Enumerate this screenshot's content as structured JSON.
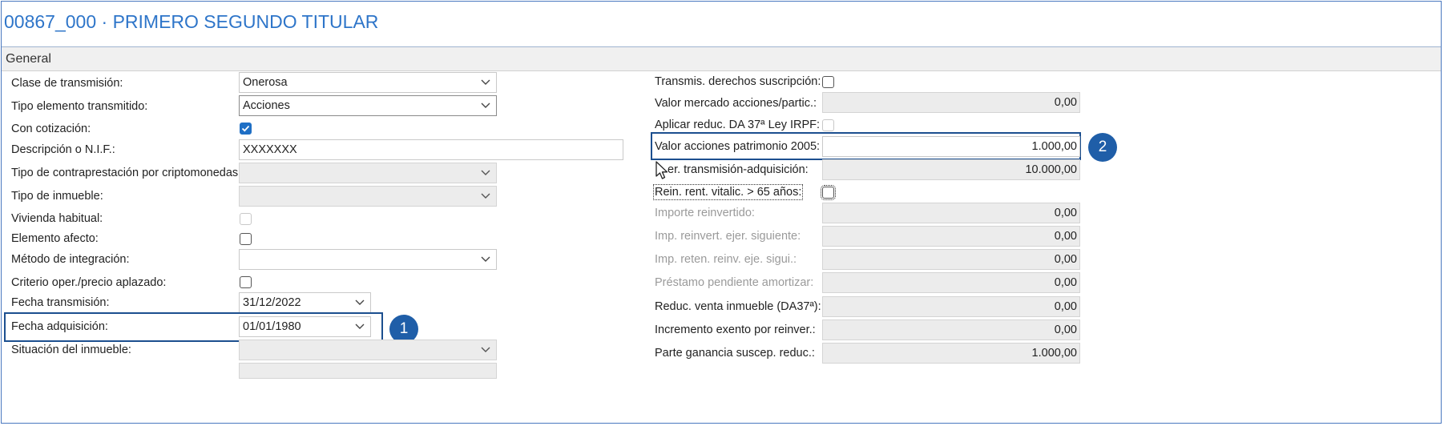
{
  "window": {
    "title": "00867_000 · PRIMERO SEGUNDO TITULAR",
    "section": "General"
  },
  "left": {
    "clase_transmision": {
      "label": "Clase de transmisión:",
      "value": "Onerosa"
    },
    "tipo_elemento": {
      "label": "Tipo elemento transmitido:",
      "value": "Acciones"
    },
    "con_cotizacion": {
      "label": "Con cotización:",
      "checked": true
    },
    "descripcion_nif": {
      "label": "Descripción o N.I.F.:",
      "value": "XXXXXXX"
    },
    "tipo_contraprestacion": {
      "label": "Tipo de contraprestación por criptomonedas:",
      "value": ""
    },
    "tipo_inmueble": {
      "label": "Tipo de inmueble:",
      "value": ""
    },
    "vivienda_habitual": {
      "label": "Vivienda habitual:",
      "checked": false
    },
    "elemento_afecto": {
      "label": "Elemento afecto:",
      "checked": false
    },
    "metodo_integracion": {
      "label": "Método de integración:",
      "value": ""
    },
    "criterio_oper": {
      "label": "Criterio oper./precio aplazado:",
      "checked": false
    },
    "fecha_transmision": {
      "label": "Fecha transmisión:",
      "value": "31/12/2022"
    },
    "fecha_adquisicion": {
      "label": "Fecha adquisición:",
      "value": "01/01/1980"
    },
    "situacion_inmueble": {
      "label": "Situación del inmueble:",
      "value": ""
    }
  },
  "right": {
    "transmis_derechos": {
      "label": "Transmis. derechos suscripción:",
      "checked": false
    },
    "valor_mercado": {
      "label": "Valor mercado acciones/partic.:",
      "value": "0,00"
    },
    "aplicar_reduc": {
      "label": "Aplicar reduc. DA 37ª Ley IRPF:",
      "checked": false
    },
    "valor_patrimonio": {
      "label": "Valor acciones patrimonio 2005:",
      "value": "1.000,00"
    },
    "dif_transmision": {
      "label": "Dif. er. transmisión-adquisición:",
      "display_label": "er. transmisión-adquisición:",
      "value": "10.000,00"
    },
    "rein_rent": {
      "label": "Rein. rent. vitalic. > 65 años:",
      "checked": false
    },
    "importe_reinvertido": {
      "label": "Importe reinvertido:",
      "value": "0,00"
    },
    "imp_reinvert": {
      "label": "Imp. reinvert. ejer. siguiente:",
      "value": "0,00"
    },
    "imp_reten": {
      "label": "Imp. reten. reinv. eje. sigui.:",
      "value": "0,00"
    },
    "prestamo": {
      "label": "Préstamo pendiente amortizar:",
      "value": "0,00"
    },
    "reduc_venta": {
      "label": "Reduc. venta inmueble (DA37ª):",
      "value": "0,00"
    },
    "incremento_exento": {
      "label": "Incremento exento por reinver.:",
      "value": "0,00"
    },
    "parte_ganancia": {
      "label": "Parte ganancia suscep. reduc.:",
      "value": "1.000,00"
    }
  },
  "annotations": {
    "badge1": "1",
    "badge2": "2"
  },
  "colors": {
    "accent": "#2e75c9",
    "highlight": "#1c4f8f",
    "badge": "#1f5ea8",
    "checkbox_on": "#1f6fc5"
  },
  "icons": [
    "chevron-down-icon",
    "checkmark-icon",
    "mouse-cursor-icon"
  ]
}
